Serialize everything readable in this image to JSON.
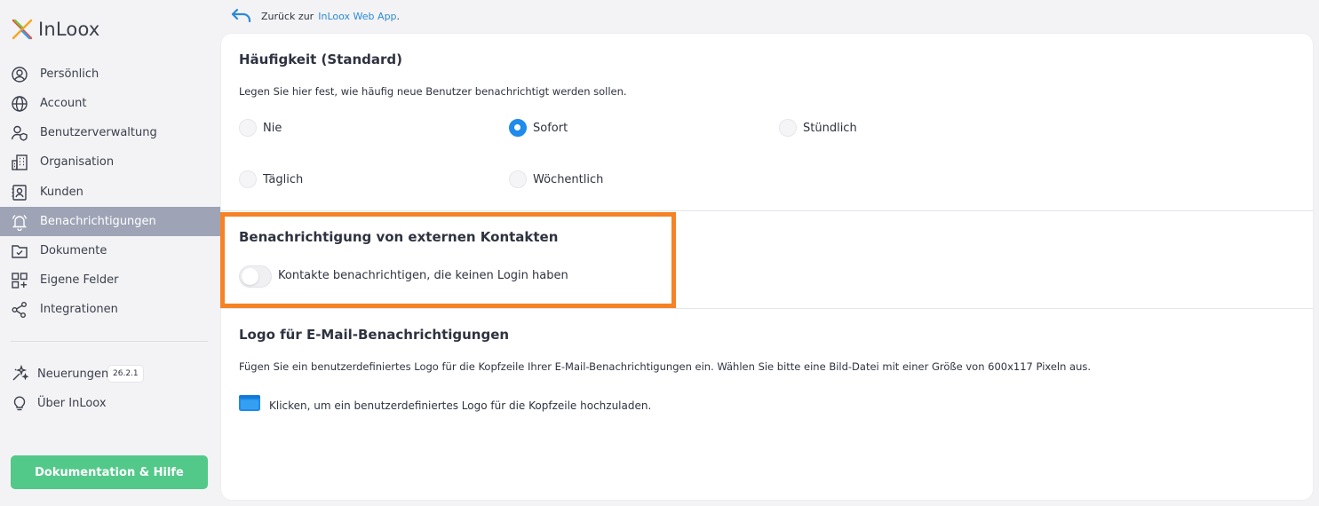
{
  "app": {
    "logo_text": "InLoox"
  },
  "backlink": {
    "prefix": "Zurück zur",
    "link": "InLoox Web App",
    "suffix": "."
  },
  "sidebar": {
    "items": [
      {
        "label": "Persönlich",
        "icon": "user-circle-icon"
      },
      {
        "label": "Account",
        "icon": "globe-icon"
      },
      {
        "label": "Benutzerverwaltung",
        "icon": "user-shield-icon"
      },
      {
        "label": "Organisation",
        "icon": "building-icon"
      },
      {
        "label": "Kunden",
        "icon": "contact-book-icon"
      },
      {
        "label": "Benachrichtigungen",
        "icon": "bell-icon",
        "active": true
      },
      {
        "label": "Dokumente",
        "icon": "folder-check-icon"
      },
      {
        "label": "Eigene Felder",
        "icon": "grid-plus-icon"
      },
      {
        "label": "Integrationen",
        "icon": "share-nodes-icon"
      }
    ],
    "extras": [
      {
        "label": "Neuerungen",
        "icon": "sparkle-icon",
        "badge": "26.2.1"
      },
      {
        "label": "Über InLoox",
        "icon": "lightbulb-icon"
      }
    ],
    "help_button": "Dokumentation & Hilfe"
  },
  "frequency": {
    "title": "Häufigkeit (Standard)",
    "description": "Legen Sie hier fest, wie häufig neue Benutzer benachrichtigt werden sollen.",
    "options": [
      {
        "label": "Nie",
        "checked": false
      },
      {
        "label": "Sofort",
        "checked": true
      },
      {
        "label": "Stündlich",
        "checked": false
      },
      {
        "label": "Täglich",
        "checked": false
      },
      {
        "label": "Wöchentlich",
        "checked": false
      }
    ]
  },
  "external": {
    "title": "Benachrichtigung von externen Kontakten",
    "toggle_label": "Kontakte benachrichtigen, die keinen Login haben",
    "toggle_on": false,
    "highlight_color": "#f58225"
  },
  "logo_section": {
    "title": "Logo für E-Mail-Benachrichtigungen",
    "description": "Fügen Sie ein benutzerdefiniertes Logo für die Kopfzeile Ihrer E-Mail-Benachrichtigungen ein. Wählen Sie bitte eine Bild-Datei mit einer Größe von 600x117 Pixeln aus.",
    "upload_label": "Klicken, um ein benutzerdefiniertes Logo für die Kopfzeile hochzuladen."
  },
  "colors": {
    "accent": "#1f8bea",
    "active_nav": "#9ea4b6",
    "help_button": "#52c989"
  }
}
